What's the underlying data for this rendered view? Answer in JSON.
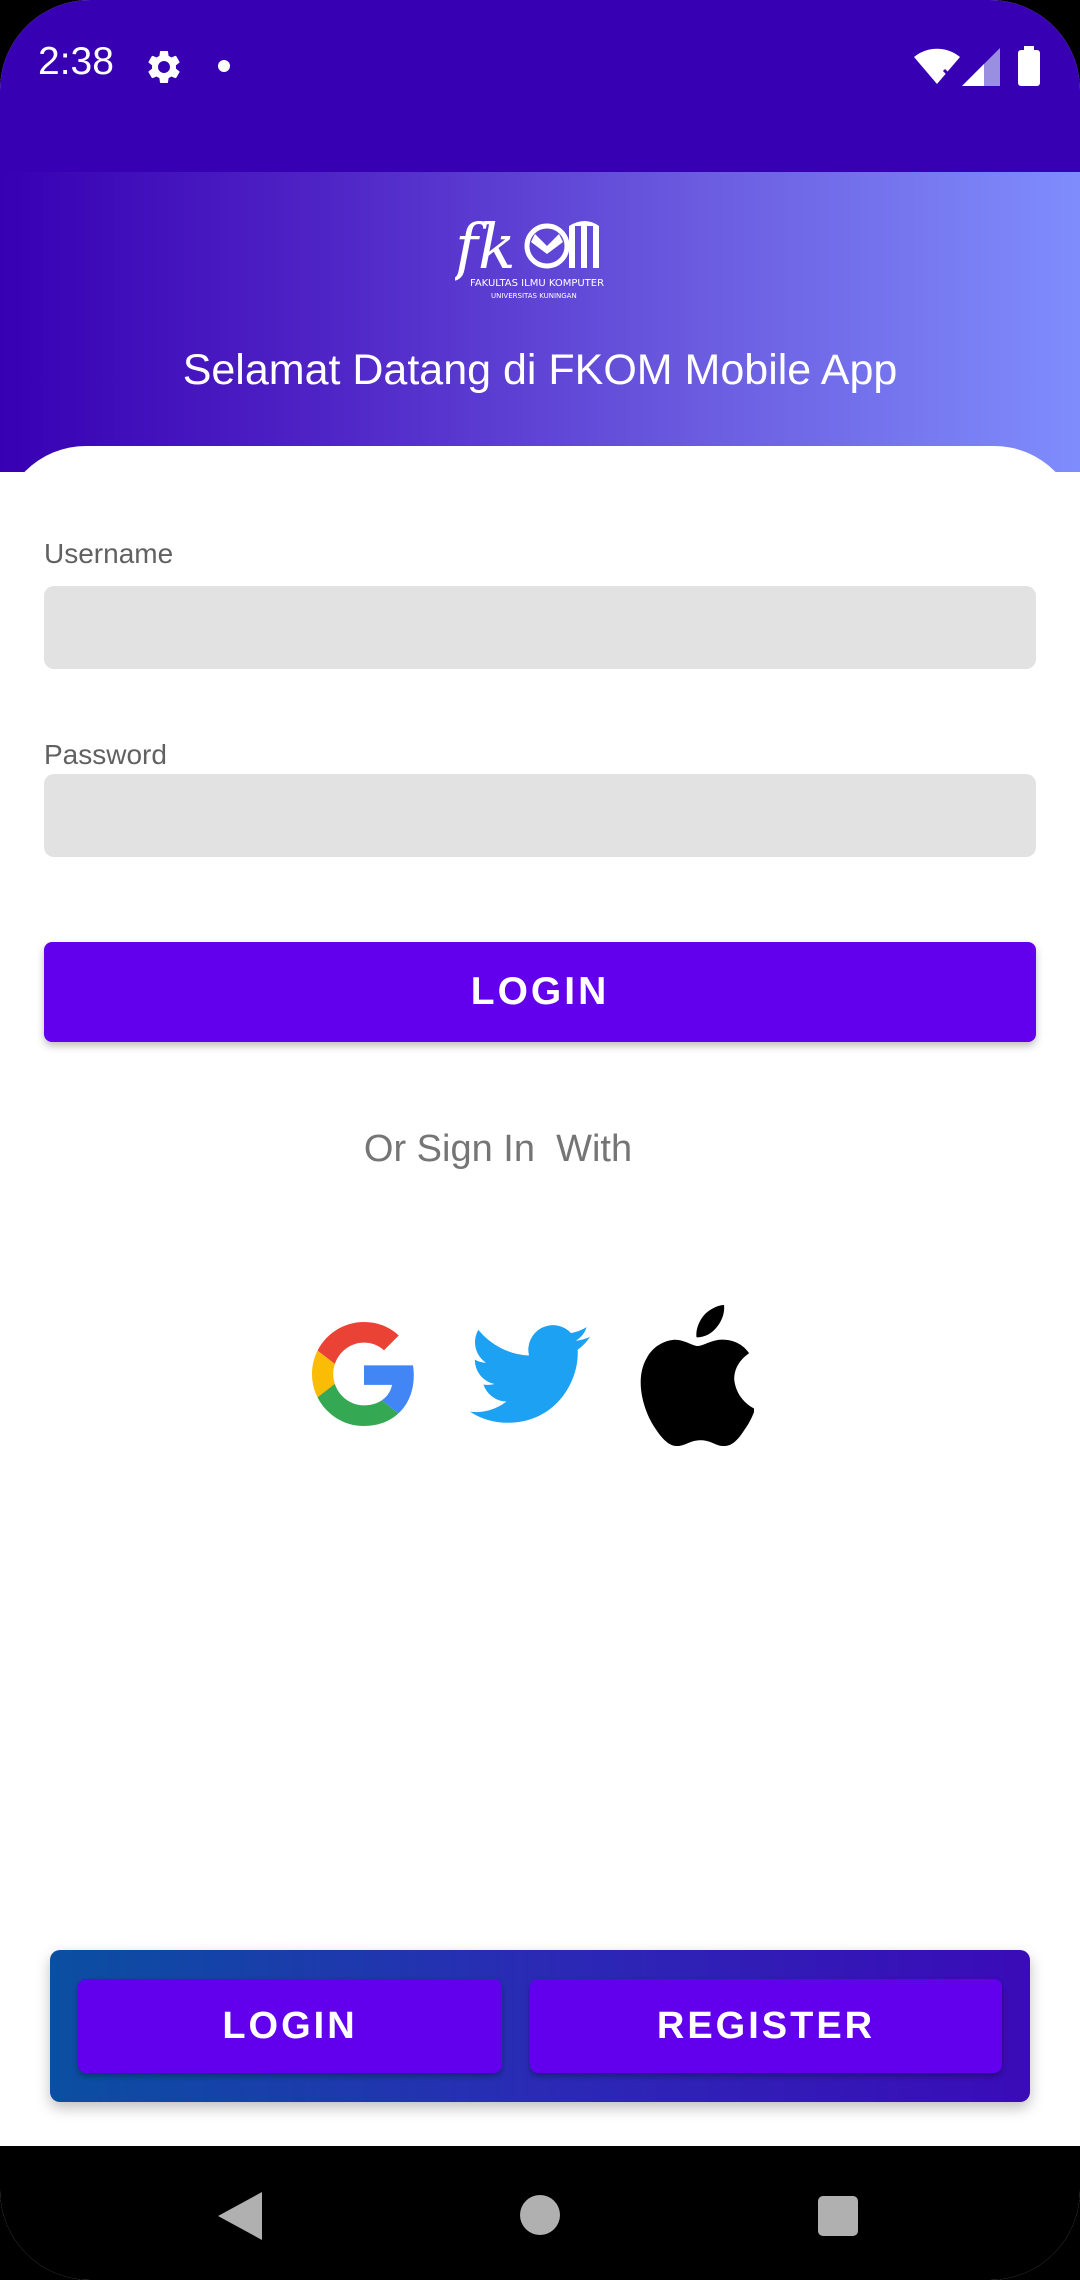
{
  "status_bar": {
    "time": "2:38",
    "settings_icon": "gear-icon",
    "notification_icon": "dot-icon",
    "wifi_icon": "wifi-off-icon",
    "signal_icon": "signal-icon",
    "battery_icon": "battery-icon"
  },
  "header": {
    "logo_icon": "fkom-logo",
    "welcome_text": "Selamat Datang di FKOM Mobile App"
  },
  "form": {
    "username_label": "Username",
    "username_value": "",
    "password_label": "Password",
    "password_value": "",
    "login_button": "LOGIN"
  },
  "social": {
    "or_text": "Or Sign In  With",
    "providers": [
      "google-icon",
      "twitter-icon",
      "apple-icon"
    ]
  },
  "bottom_bar": {
    "login_button": "LOGIN",
    "register_button": "REGISTER"
  },
  "nav_bar": {
    "back_icon": "back-icon",
    "home_icon": "home-icon",
    "recents_icon": "recents-icon"
  },
  "colors": {
    "primary": "#6200EE",
    "primary_dark": "#3700B3",
    "input_bg": "#E2E2E2",
    "gradient_end": "#7F8DFC"
  }
}
